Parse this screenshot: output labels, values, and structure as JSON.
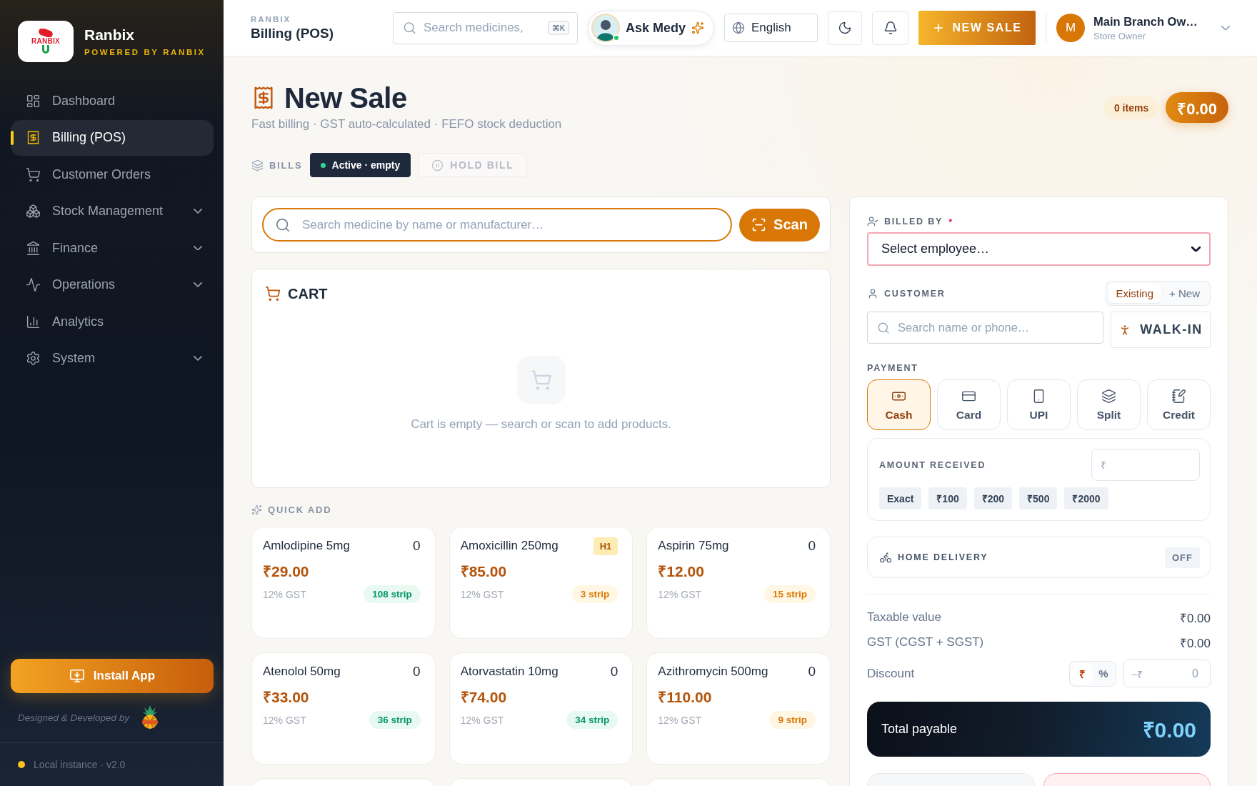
{
  "sidebar": {
    "brand": {
      "logo_text": "RANBIX",
      "name": "Ranbix",
      "tagline": "POWERED BY RANBIX"
    },
    "nav": [
      {
        "label": "Dashboard",
        "selected": false,
        "has_submenu": false
      },
      {
        "label": "Billing (POS)",
        "selected": true,
        "has_submenu": false
      },
      {
        "label": "Customer Orders",
        "selected": false,
        "has_submenu": false
      },
      {
        "label": "Stock Management",
        "selected": false,
        "has_submenu": true
      },
      {
        "label": "Finance",
        "selected": false,
        "has_submenu": true
      },
      {
        "label": "Operations",
        "selected": false,
        "has_submenu": true
      },
      {
        "label": "Analytics",
        "selected": false,
        "has_submenu": false
      },
      {
        "label": "System",
        "selected": false,
        "has_submenu": true
      }
    ],
    "install_button": "Install App",
    "credit": "Designed & Developed by",
    "instance": "Local instance · v2.0"
  },
  "topbar": {
    "eyebrow": "RANBIX",
    "title": "Billing (POS)",
    "search": {
      "placeholder": "Search medicines,",
      "shortcut": "⌘K"
    },
    "assistant": {
      "label": "Ask Medy",
      "online": true
    },
    "language": "English",
    "new_sale_button": "NEW SALE",
    "user": {
      "initial": "M",
      "name": "Main Branch Ow…",
      "role": "Store Owner"
    }
  },
  "page": {
    "title": "New Sale",
    "subtitle": "Fast billing · GST auto-calculated · FEFO stock deduction",
    "item_count": "0 items",
    "total": "₹0.00"
  },
  "bills": {
    "label": "BILLS",
    "tabs": [
      {
        "label": "Active · empty",
        "selected": true
      }
    ],
    "hold_button": {
      "label": "HOLD BILL",
      "disabled": true
    }
  },
  "product_search": {
    "placeholder": "Search medicine by name or manufacturer…",
    "scan_button": "Scan"
  },
  "cart": {
    "title": "CART",
    "empty_message": "Cart is empty — search or scan to add products."
  },
  "quick_add": {
    "title": "QUICK ADD",
    "products": [
      {
        "kind": "product",
        "name": "Amlodipine 5mg",
        "count": "0",
        "price": "₹29.00",
        "tax": "12% GST",
        "stock": "108 strip",
        "low_stock": false
      },
      {
        "kind": "product",
        "name": "Amoxicillin 250mg",
        "schedule": "H1",
        "price": "₹85.00",
        "tax": "12% GST",
        "stock": "3 strip",
        "low_stock": true
      },
      {
        "kind": "product",
        "name": "Aspirin 75mg",
        "count": "0",
        "price": "₹12.00",
        "tax": "12% GST",
        "stock": "15 strip",
        "low_stock": true
      },
      {
        "kind": "product",
        "name": "Atenolol 50mg",
        "count": "0",
        "price": "₹33.00",
        "tax": "12% GST",
        "stock": "36 strip",
        "low_stock": false
      },
      {
        "kind": "product",
        "name": "Atorvastatin 10mg",
        "count": "0",
        "price": "₹74.00",
        "tax": "12% GST",
        "stock": "34 strip",
        "low_stock": false
      },
      {
        "kind": "product",
        "name": "Azithromycin 500mg",
        "count": "0",
        "price": "₹110.00",
        "tax": "12% GST",
        "stock": "9 strip",
        "low_stock": true
      },
      {
        "kind": "clipped"
      },
      {
        "kind": "clipped"
      },
      {
        "kind": "clipped"
      }
    ]
  },
  "checkout": {
    "billed_by": {
      "label": "BILLED BY",
      "required_mark": "*",
      "value": "Select employee…",
      "invalid": true
    },
    "customer": {
      "label": "CUSTOMER",
      "modes": [
        {
          "label": "Existing",
          "selected": true
        },
        {
          "label": "+ New",
          "selected": false
        }
      ],
      "search_placeholder": "Search name or phone…",
      "walk_in_button": "WALK-IN"
    },
    "payment": {
      "label": "PAYMENT",
      "methods": [
        {
          "label": "Cash",
          "selected": true
        },
        {
          "label": "Card",
          "selected": false
        },
        {
          "label": "UPI",
          "selected": false
        },
        {
          "label": "Split",
          "selected": false
        },
        {
          "label": "Credit",
          "selected": false
        }
      ]
    },
    "amount_received": {
      "label": "AMOUNT RECEIVED",
      "placeholder": "₹",
      "presets": [
        "Exact",
        "₹100",
        "₹200",
        "₹500",
        "₹2000"
      ]
    },
    "home_delivery": {
      "label": "HOME DELIVERY",
      "on": false,
      "state_label": "OFF"
    },
    "summary": [
      {
        "label": "Taxable value",
        "value": "₹0.00"
      },
      {
        "label": "GST (CGST + SGST)",
        "value": "₹0.00"
      }
    ],
    "discount": {
      "label": "Discount",
      "units": [
        {
          "label": "₹",
          "selected": true
        },
        {
          "label": "%",
          "selected": false
        }
      ],
      "prefix": "−₹",
      "placeholder": "0"
    },
    "total": {
      "label": "Total payable",
      "value": "₹0.00"
    },
    "action_buttons": [
      {
        "kind": "neutral"
      },
      {
        "kind": "danger"
      }
    ]
  }
}
